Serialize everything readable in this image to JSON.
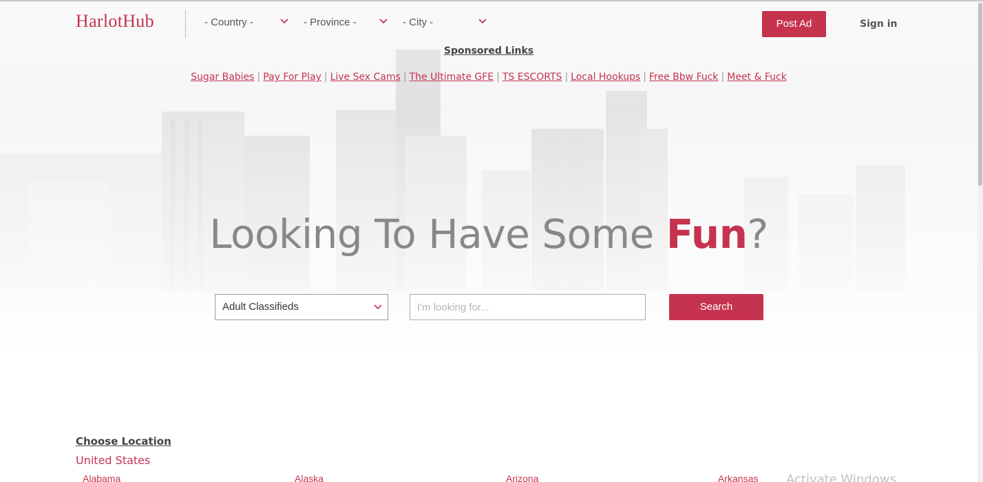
{
  "header": {
    "logo": "HarlotHub",
    "country_select": "- Country -",
    "province_select": "- Province -",
    "city_select": "- City -",
    "post_ad": "Post Ad",
    "sign_in": "Sign in"
  },
  "sponsored": {
    "title": "Sponsored Links",
    "links": [
      "Sugar Babies",
      "Pay For Play",
      "Live Sex Cams",
      "The Ultimate GFE",
      "TS ESCORTS",
      "Local Hookups",
      "Free Bbw Fuck",
      "Meet & Fuck"
    ],
    "separator": "|"
  },
  "hero": {
    "title_before": "Looking To Have Some ",
    "title_accent": "Fun",
    "title_after": "?"
  },
  "search": {
    "category_value": "Adult Classifieds",
    "placeholder": "I'm looking for...",
    "button": "Search"
  },
  "locations": {
    "title": "Choose Location",
    "country": "United States",
    "states": [
      "Alabama",
      "Alaska",
      "Arizona",
      "Arkansas"
    ]
  },
  "watermark": "Activate Windows",
  "icons": {
    "dropdown": "chevron-down-icon"
  },
  "colors": {
    "accent": "#c5334f",
    "hero_text": "#888888"
  }
}
